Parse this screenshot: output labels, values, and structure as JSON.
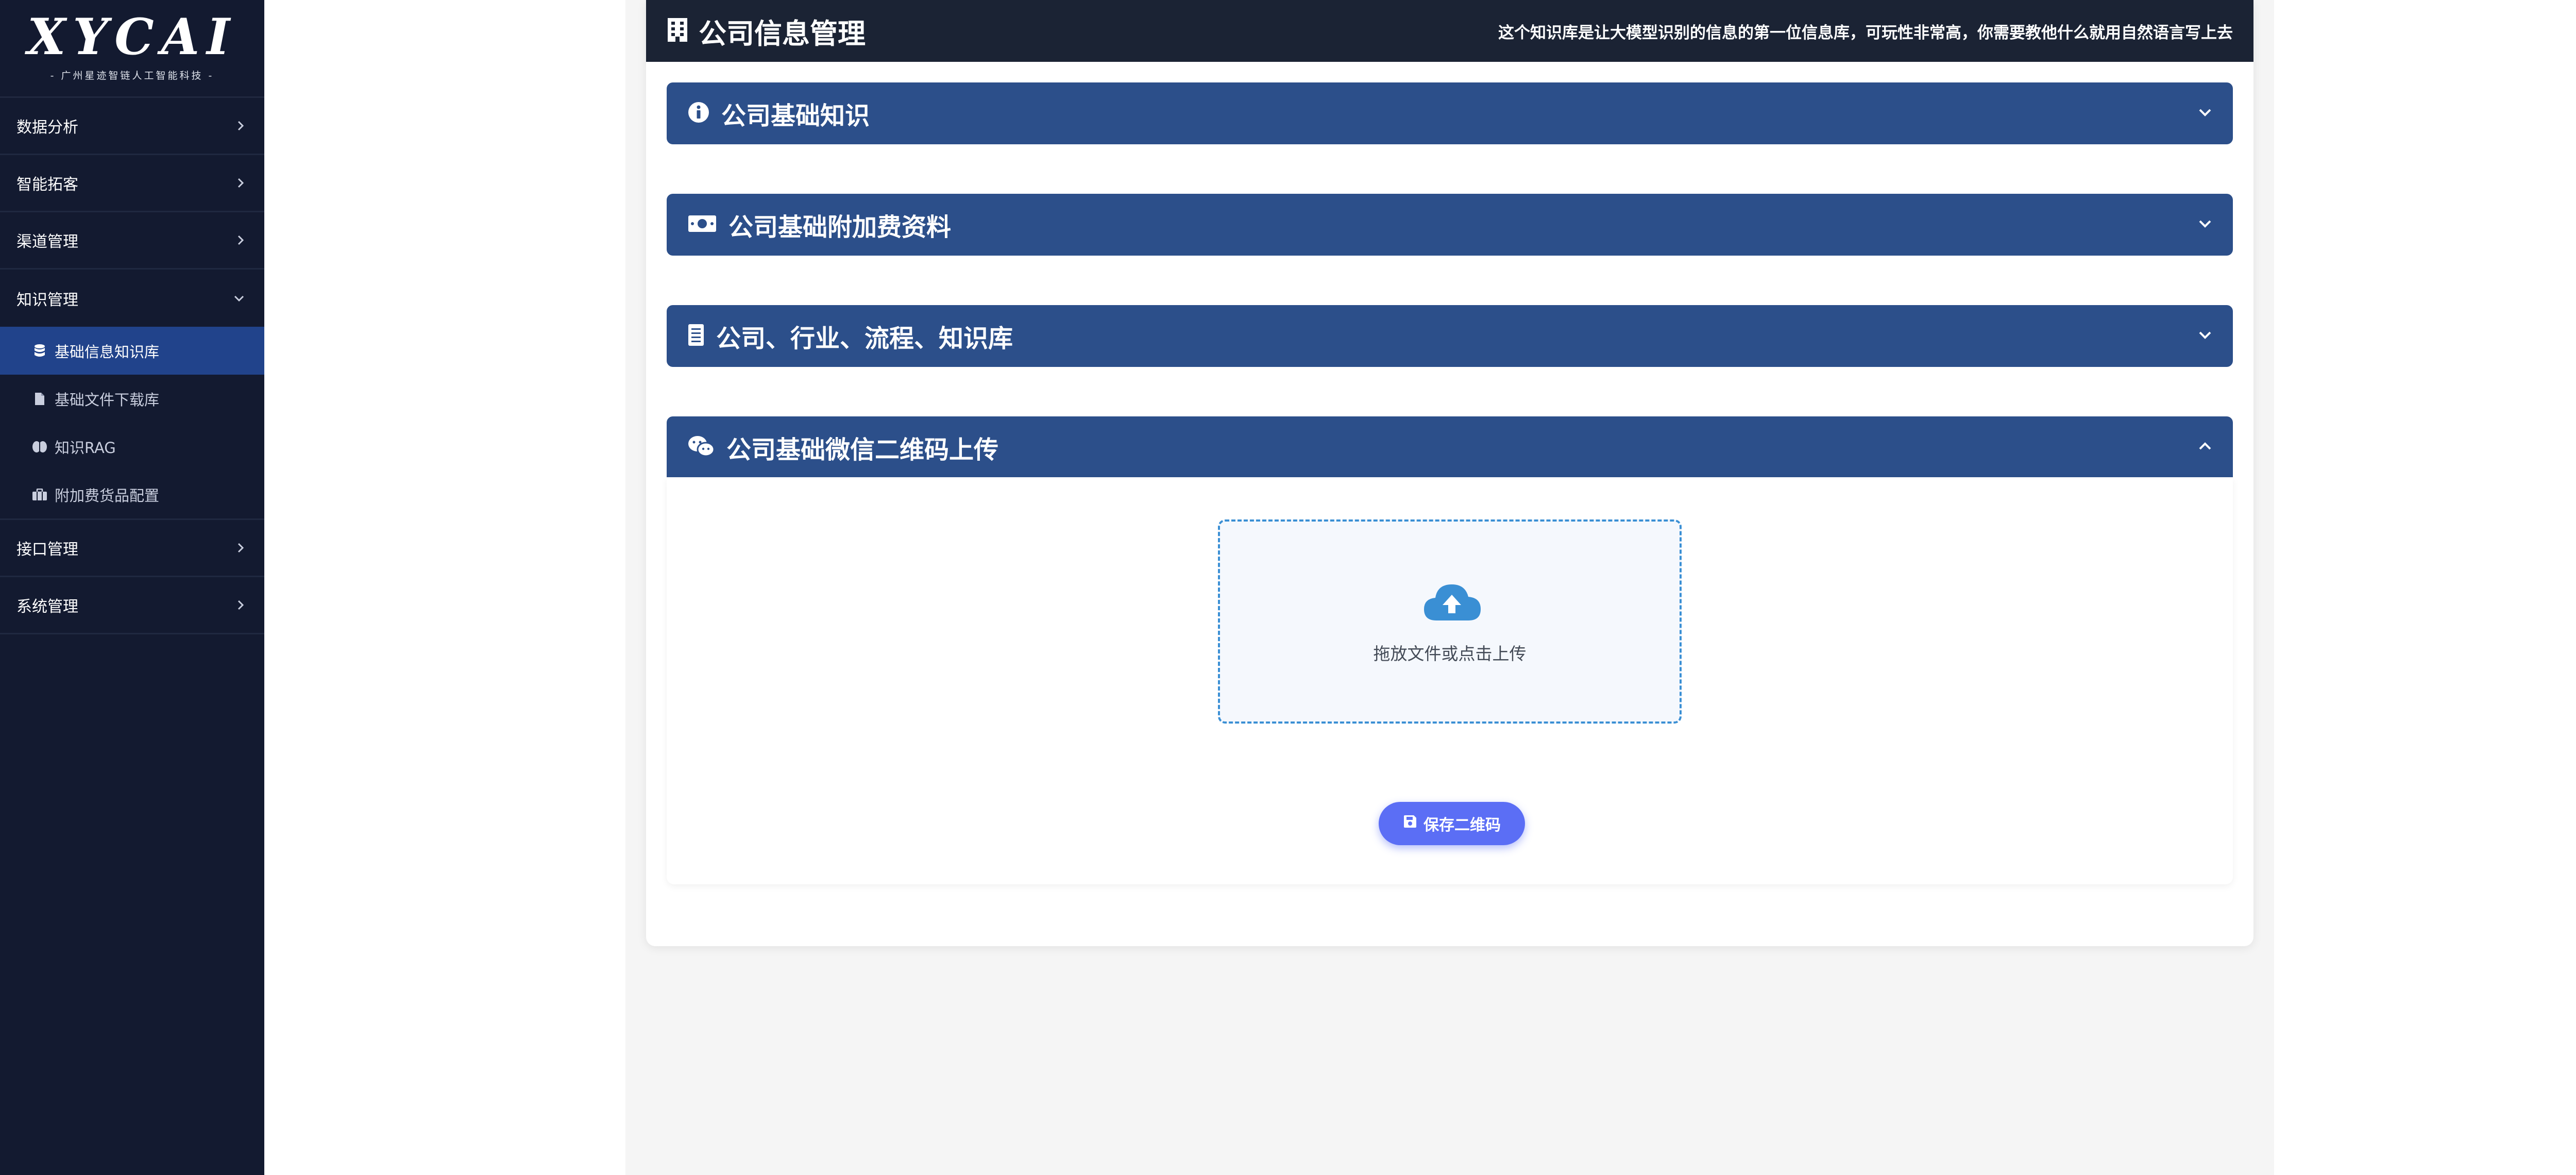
{
  "sidebar": {
    "logo": {
      "text": "XYCAI",
      "subtitle": "- 广州星迹智链人工智能科技 -"
    },
    "items": [
      {
        "label": "数据分析",
        "expanded": false
      },
      {
        "label": "智能拓客",
        "expanded": false
      },
      {
        "label": "渠道管理",
        "expanded": false
      },
      {
        "label": "知识管理",
        "expanded": true,
        "children": [
          {
            "label": "基础信息知识库",
            "icon": "database-icon",
            "active": true
          },
          {
            "label": "基础文件下载库",
            "icon": "file-icon",
            "active": false
          },
          {
            "label": "知识RAG",
            "icon": "brain-icon",
            "active": false
          },
          {
            "label": "附加费货品配置",
            "icon": "boxes-icon",
            "active": false
          }
        ]
      },
      {
        "label": "接口管理",
        "expanded": false
      },
      {
        "label": "系统管理",
        "expanded": false
      }
    ]
  },
  "page": {
    "title": "公司信息管理",
    "title_icon": "building-icon",
    "description": "这个知识库是让大模型识别的信息的第一位信息库，可玩性非常高，你需要教他什么就用自然语言写上去"
  },
  "sections": [
    {
      "title": "公司基础知识",
      "icon": "info-circle-icon",
      "expanded": false
    },
    {
      "title": "公司基础附加费资料",
      "icon": "money-bill-icon",
      "expanded": false
    },
    {
      "title": "公司、行业、流程、知识库",
      "icon": "book-icon",
      "expanded": false
    },
    {
      "title": "公司基础微信二维码上传",
      "icon": "wechat-icon",
      "expanded": true
    }
  ],
  "upload": {
    "icon": "cloud-upload-icon",
    "text": "拖放文件或点击上传",
    "save_label": "保存二维码",
    "save_icon": "save-icon"
  },
  "colors": {
    "sidebar_bg": "#131a30",
    "active_item": "#21438b",
    "header_bg": "#1b2334",
    "section_bg": "#2c4f8a",
    "dropzone_border": "#3a8fd4",
    "save_button": "#5b6ef5"
  }
}
